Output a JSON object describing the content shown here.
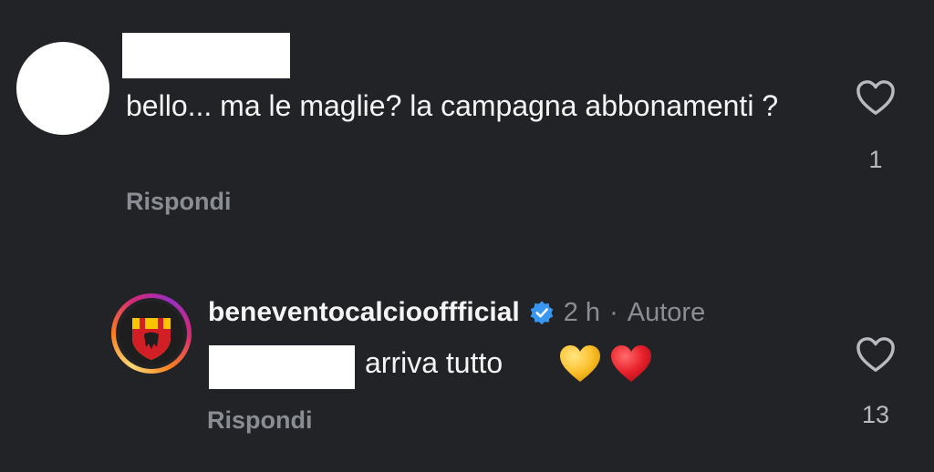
{
  "comment": {
    "text": "bello... ma le maglie? la campagna abbonamenti ?",
    "reply_label": "Rispondi",
    "like_count": "1"
  },
  "reply": {
    "username": "beneventocalciooffficial",
    "time": "2 h",
    "separator": "·",
    "author_tag": "Autore",
    "text": "arriva tutto",
    "reply_label": "Rispondi",
    "like_count": "13"
  },
  "colors": {
    "background": "#212327",
    "text": "#f5f5f5",
    "muted": "#8a8d93",
    "verified": "#3897f0",
    "club_red": "#d21f26",
    "club_yellow": "#f7c600"
  },
  "icons": {
    "like": "heart-outline-icon",
    "verified": "verified-badge-icon",
    "emoji_1": "yellow-heart-emoji",
    "emoji_2": "red-heart-emoji"
  }
}
